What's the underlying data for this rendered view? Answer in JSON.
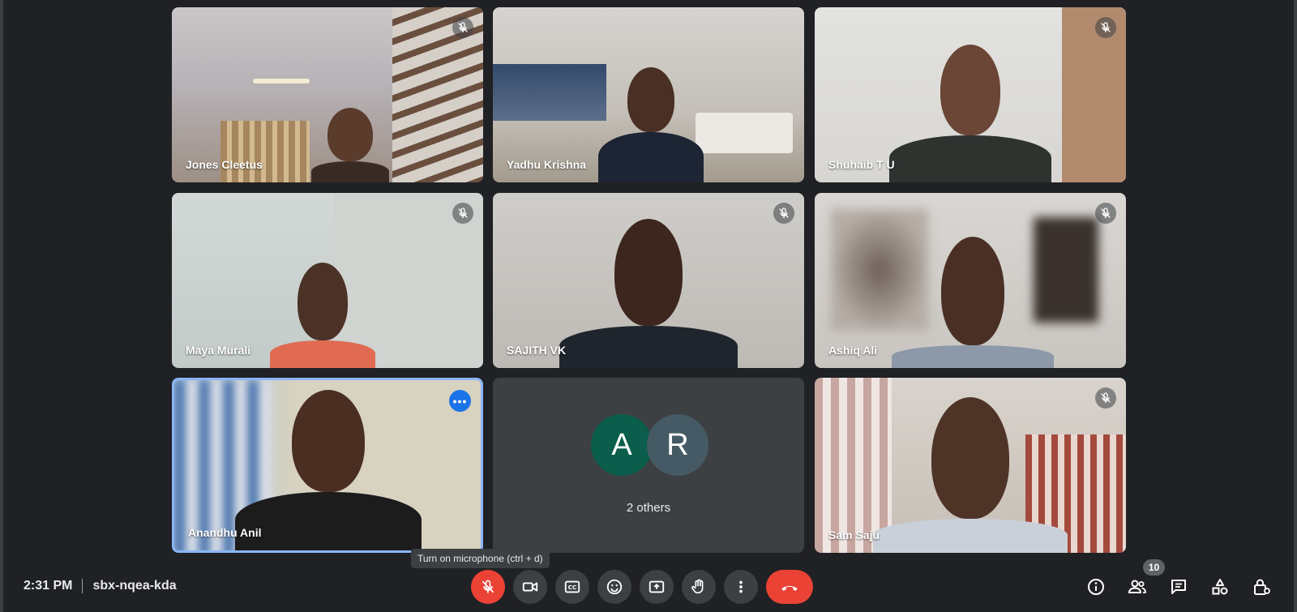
{
  "meeting": {
    "time": "2:31 PM",
    "code": "sbx-nqea-kda"
  },
  "tiles": [
    {
      "name": "Jones Cleetus",
      "muted": true
    },
    {
      "name": "Yadhu Krishna",
      "muted": false
    },
    {
      "name": "Shuhaib T U",
      "muted": true
    },
    {
      "name": "Maya Murali",
      "muted": true
    },
    {
      "name": "SAJITH VK",
      "muted": true
    },
    {
      "name": "Ashiq Ali",
      "muted": true
    },
    {
      "name": "Anandhu Anil",
      "muted": false,
      "self": true
    },
    {
      "name": "Sam Saju",
      "muted": true
    }
  ],
  "others_tile": {
    "avatars": [
      {
        "initial": "A",
        "color": "#0b5e4b"
      },
      {
        "initial": "R",
        "color": "#455a64"
      }
    ],
    "label": "2 others"
  },
  "tooltip": "Turn on microphone (ctrl + d)",
  "participants_count": "10",
  "icons": {
    "mic": "mic-off-icon",
    "camera": "videocam-icon",
    "captions": "closed-caption-icon",
    "reactions": "emoji-icon",
    "present": "present-screen-icon",
    "raise_hand": "hand-icon",
    "more": "more-vert-icon",
    "leave": "call-end-icon",
    "info": "info-icon",
    "people": "people-icon",
    "chat": "chat-icon",
    "activities": "activities-icon",
    "host_controls": "lock-person-icon"
  },
  "colors": {
    "background": "#202124",
    "tile_dark": "#3c4043",
    "accent_blue": "#8ab4f8",
    "danger_red": "#ea4335"
  }
}
